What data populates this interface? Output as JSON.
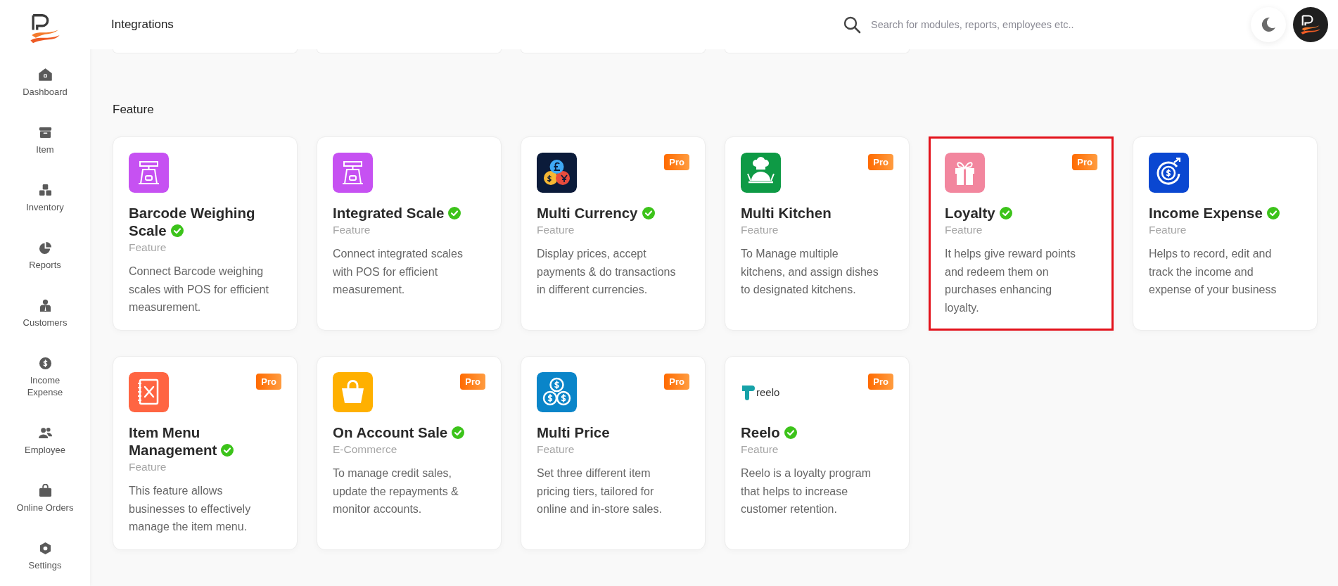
{
  "sidebar": {
    "items": [
      {
        "label": "Dashboard",
        "kind": "home"
      },
      {
        "label": "Item",
        "kind": "archive"
      },
      {
        "label": "Inventory",
        "kind": "boxes"
      },
      {
        "label": "Reports",
        "kind": "pie"
      },
      {
        "label": "Customers",
        "kind": "person"
      },
      {
        "label": "Income Expense",
        "kind": "dollar"
      },
      {
        "label": "Employee",
        "kind": "people"
      },
      {
        "label": "Online Orders",
        "kind": "bag"
      },
      {
        "label": "Settings",
        "kind": "hexagon"
      }
    ]
  },
  "header": {
    "title": "Integrations",
    "search": {
      "placeholder": "Search for modules, reports, employees etc.."
    }
  },
  "clipped_section": {
    "cards": [
      {
        "kind": "card"
      },
      {
        "kind": "card"
      },
      {
        "kind": "card"
      },
      {
        "kind": "card"
      }
    ]
  },
  "section": {
    "title": "Feature",
    "cards": [
      {
        "title": "Barcode Weighing Scale",
        "category": "Feature",
        "description": "Connect Barcode weighing scales with POS for efficient measurement.",
        "verified": true,
        "highlighted": false,
        "icon": {
          "kind": "scale",
          "color": "#c651f2"
        }
      },
      {
        "title": "Integrated Scale",
        "category": "Feature",
        "description": "Connect integrated scales with POS for efficient measurement.",
        "verified": true,
        "highlighted": false,
        "icon": {
          "kind": "scale",
          "color": "#c651f2"
        }
      },
      {
        "title": "Multi Currency",
        "category": "Feature",
        "description": "Display prices, accept payments & do transactions in different currencies.",
        "verified": true,
        "highlighted": false,
        "badge": "Pro",
        "icon": {
          "kind": "currency",
          "color": "#0b1b3a"
        }
      },
      {
        "title": "Multi Kitchen",
        "category": "Feature",
        "description": "To Manage multiple kitchens, and assign dishes to designated kitchens.",
        "verified": false,
        "highlighted": false,
        "badge": "Pro",
        "icon": {
          "kind": "chef",
          "color": "#0e9a45"
        }
      },
      {
        "title": "Loyalty",
        "category": "Feature",
        "description": "It helps give reward points and redeem them on purchases enhancing loyalty.",
        "verified": true,
        "highlighted": true,
        "badge": "Pro",
        "icon": {
          "kind": "gift",
          "color": "#f2869e"
        }
      },
      {
        "title": "Income Expense",
        "category": "Feature",
        "description": "Helps to record, edit and track the income and expense of your business",
        "verified": true,
        "highlighted": false,
        "icon": {
          "kind": "cashflow",
          "color": "#0a47d1"
        }
      },
      {
        "title": "Item Menu Management",
        "category": "Feature",
        "description": "This feature allows businesses to effectively manage the item menu.",
        "verified": true,
        "highlighted": false,
        "badge": "Pro",
        "icon": {
          "kind": "menu",
          "color": "#ff6542"
        }
      },
      {
        "title": "On Account Sale",
        "category": "E-Commerce",
        "description": "To manage credit sales, update the repayments & monitor accounts.",
        "verified": true,
        "highlighted": false,
        "badge": "Pro",
        "icon": {
          "kind": "basket",
          "color": "#ffb000"
        }
      },
      {
        "title": "Multi Price",
        "category": "Feature",
        "description": "Set three different item pricing tiers, tailored for online and in-store sales.",
        "verified": false,
        "highlighted": false,
        "badge": "Pro",
        "icon": {
          "kind": "coins",
          "color": "#0a85c9"
        }
      },
      {
        "title": "Reelo",
        "category": "Feature",
        "description": "Reelo is a loyalty program that helps to increase customer retention.",
        "verified": true,
        "highlighted": false,
        "badge": "Pro",
        "icon": {
          "kind": "reelo",
          "color": "#17a2a8",
          "logo_text": "reelo"
        }
      }
    ]
  }
}
